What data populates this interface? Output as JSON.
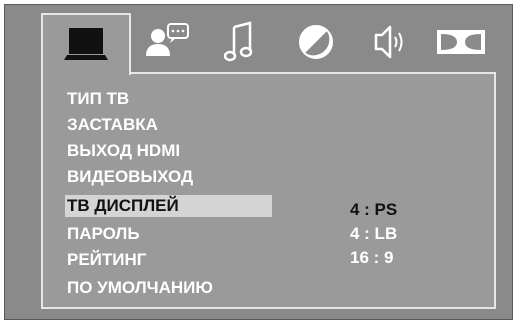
{
  "tabs": [
    {
      "id": "display",
      "icon": "tv-monitor-icon",
      "active": true
    },
    {
      "id": "language",
      "icon": "person-speech-bubble-icon",
      "active": false
    },
    {
      "id": "audio",
      "icon": "music-note-icon",
      "active": false
    },
    {
      "id": "parental",
      "icon": "circle-slash-icon",
      "active": false
    },
    {
      "id": "speaker",
      "icon": "speaker-icon",
      "active": false
    },
    {
      "id": "dolby",
      "icon": "dolby-double-d-icon",
      "active": false
    }
  ],
  "menu": {
    "items": [
      {
        "label": "ТИП ТВ"
      },
      {
        "label": "ЗАСТАВКА"
      },
      {
        "label": "ВЫХОД HDMI"
      },
      {
        "label": "ВИДЕОВЫХОД"
      },
      {
        "label": "ТВ ДИСПЛЕЙ",
        "selected": true
      },
      {
        "label": "ПАРОЛЬ"
      },
      {
        "label": "РЕЙТИНГ"
      },
      {
        "label": "ПО УМОЛЧАНИЮ"
      }
    ],
    "options": [
      {
        "label": "4 : PS",
        "current": true
      },
      {
        "label": "4 : LB",
        "current": false
      },
      {
        "label": "16 : 9",
        "current": false
      }
    ]
  },
  "colors": {
    "background": "#8a8a8a",
    "panel": "#9a9a9a",
    "border": "#e6e6e6",
    "text": "#ffffff",
    "highlight": "#d4d4d4",
    "highlight_text": "#111111",
    "icon": "#ffffff",
    "active_icon": "#111111"
  }
}
